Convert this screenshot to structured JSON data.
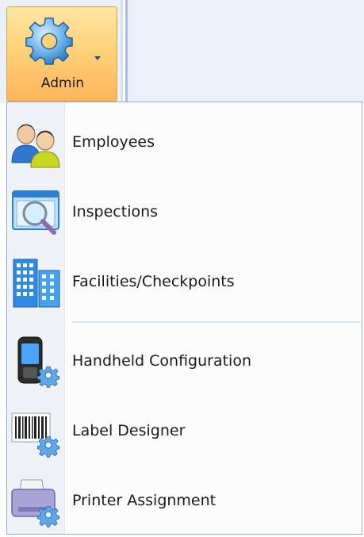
{
  "ribbon": {
    "admin_button": {
      "label": "Admin",
      "icon": "gear-icon"
    }
  },
  "menu": {
    "items": [
      {
        "label": "Employees",
        "icon": "employees-icon"
      },
      {
        "label": "Inspections",
        "icon": "inspections-icon"
      },
      {
        "label": "Facilities/Checkpoints",
        "icon": "buildings-icon"
      },
      {
        "label": "Handheld Configuration",
        "icon": "handheld-device-icon"
      },
      {
        "label": "Label Designer",
        "icon": "barcode-icon"
      },
      {
        "label": "Printer Assignment",
        "icon": "printer-icon"
      }
    ]
  },
  "colors": {
    "button_highlight": "#fcb55a",
    "menu_border": "#9aa9bd",
    "gear_blue": "#3a8fd8"
  }
}
